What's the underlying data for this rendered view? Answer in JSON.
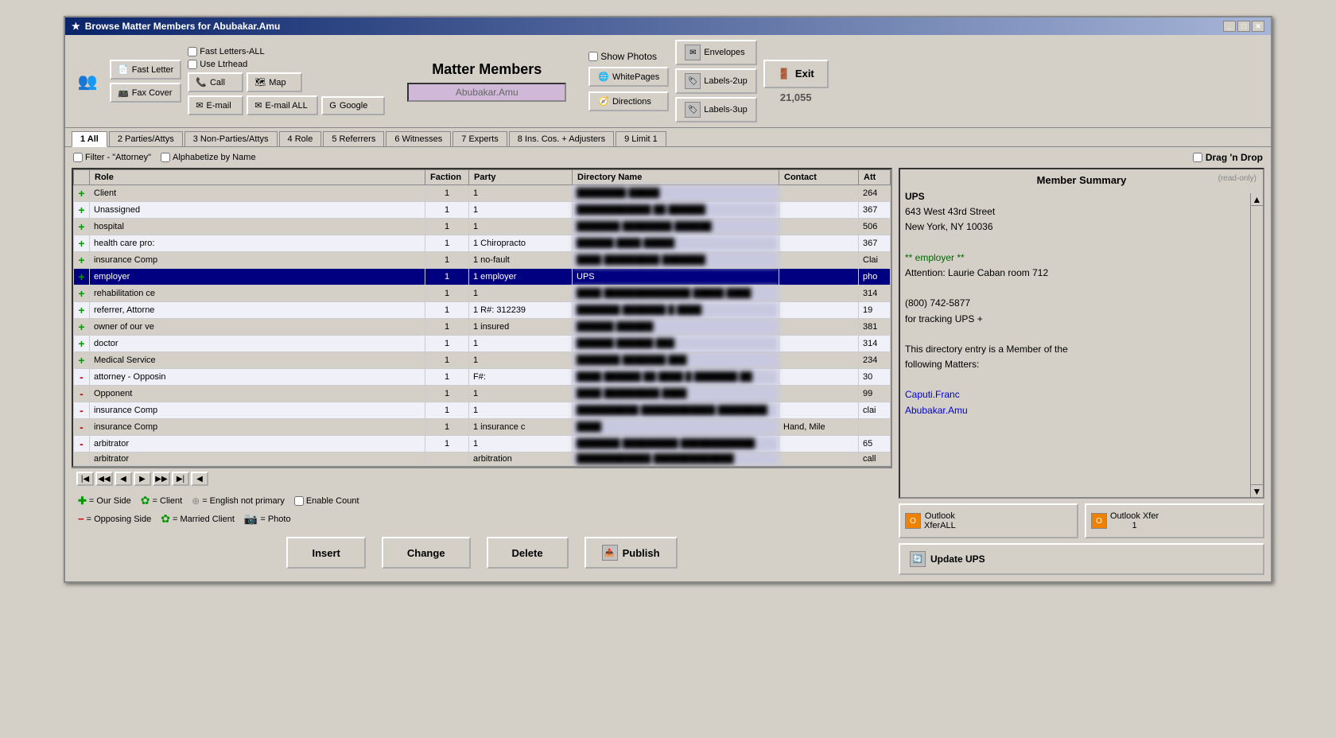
{
  "window": {
    "title": "Browse Matter Members for Abubakar.Amu",
    "title_icon": "★"
  },
  "toolbar": {
    "fast_letter_label": "Fast Letter",
    "fax_cover_label": "Fax Cover",
    "fast_letters_all": "Fast Letters-ALL",
    "use_ltrhead": "Use Ltrhead",
    "call_label": "Call",
    "map_label": "Map",
    "email_label": "E-mail",
    "email_all_label": "E-mail ALL",
    "google_label": "Google",
    "show_photos_label": "Show Photos",
    "whitepages_label": "WhitePages",
    "directions_label": "Directions",
    "envelopes_label": "Envelopes",
    "labels_2up_label": "Labels-2up",
    "labels_3up_label": "Labels-3up",
    "exit_label": "Exit",
    "matter_title": "Matter Members",
    "matter_name": "Abubakar.Amu",
    "count": "21,055"
  },
  "tabs": [
    {
      "id": "1",
      "label": "1 All",
      "active": true
    },
    {
      "id": "2",
      "label": "2 Parties/Attys"
    },
    {
      "id": "3",
      "label": "3 Non-Parties/Attys"
    },
    {
      "id": "4",
      "label": "4 Role"
    },
    {
      "id": "5",
      "label": "5 Referrers"
    },
    {
      "id": "6",
      "label": "6 Witnesses"
    },
    {
      "id": "7",
      "label": "7 Experts"
    },
    {
      "id": "8",
      "label": "8 Ins. Cos. + Adjusters"
    },
    {
      "id": "9",
      "label": "9 Limit 1"
    }
  ],
  "filter": {
    "filter_attorney": "Filter - \"Attorney\"",
    "alphabetize_label": "Alphabetize by Name",
    "drag_drop_label": "Drag 'n Drop"
  },
  "table": {
    "headers": [
      "Role",
      "Faction",
      "Party",
      "Directory Name",
      "Contact",
      "Att"
    ],
    "rows": [
      {
        "icon": "+",
        "role": "Client",
        "faction": "1",
        "party": "1",
        "dir_name": "████████ █████",
        "contact": "",
        "att": "264"
      },
      {
        "icon": "+",
        "role": "Unassigned",
        "faction": "1",
        "party": "1",
        "dir_name": "████████████ ██ ██████",
        "contact": "",
        "att": "367"
      },
      {
        "icon": "+",
        "role": "hospital",
        "faction": "1",
        "party": "1",
        "dir_name": "███████ ████████ ██████",
        "contact": "",
        "att": "506"
      },
      {
        "icon": "+",
        "role": "health care pro:",
        "faction": "1",
        "party": "1 Chiropracto",
        "dir_name": "██████ ████ █████",
        "contact": "",
        "att": "367"
      },
      {
        "icon": "+",
        "role": "insurance Comp",
        "faction": "1",
        "party": "1 no-fault",
        "dir_name": "████ █████████ ███████",
        "contact": "",
        "att": "Clai"
      },
      {
        "icon": "+",
        "role": "employer",
        "faction": "1",
        "party": "1 employer",
        "dir_name": "UPS",
        "contact": "",
        "att": "pho",
        "selected": true
      },
      {
        "icon": "+",
        "role": "rehabilitation ce",
        "faction": "1",
        "party": "1",
        "dir_name": "████ ██████████████ █████ ████",
        "contact": "",
        "att": "314"
      },
      {
        "icon": "+",
        "role": "referrer, Attorne",
        "faction": "1",
        "party": "1 R#: 312239",
        "dir_name": "███████ ███████ █ ████",
        "contact": "",
        "att": "19"
      },
      {
        "icon": "+",
        "role": "owner of our ve",
        "faction": "1",
        "party": "1 insured",
        "dir_name": "██████ ██████",
        "contact": "",
        "att": "381"
      },
      {
        "icon": "+",
        "role": "doctor",
        "faction": "1",
        "party": "1",
        "dir_name": "██████ ██████ ███",
        "contact": "",
        "att": "314"
      },
      {
        "icon": "+",
        "role": "Medical Service",
        "faction": "1",
        "party": "1",
        "dir_name": "███████ ███████ ███",
        "contact": "",
        "att": "234"
      },
      {
        "icon": "-",
        "role": "attorney - Opposin",
        "faction": "1",
        "party": "F#:",
        "dir_name": "████ ██████ ██ ████ █ ███████ ██",
        "contact": "",
        "att": "30"
      },
      {
        "icon": "-",
        "role": "Opponent",
        "faction": "1",
        "party": "1",
        "dir_name": "████ █████████ ████",
        "contact": "",
        "att": "99"
      },
      {
        "icon": "-",
        "role": "insurance Comp",
        "faction": "1",
        "party": "1",
        "dir_name": "██████████ ████████████ ████████",
        "contact": "",
        "att": "clai"
      },
      {
        "icon": "-",
        "role": "insurance Comp",
        "faction": "1",
        "party": "1 insurance c",
        "dir_name": "████",
        "contact": "Hand, Mile",
        "att": ""
      },
      {
        "icon": "-",
        "role": "arbitrator",
        "faction": "1",
        "party": "1",
        "dir_name": "███████ █████████ ████████████",
        "contact": "",
        "att": "65"
      },
      {
        "icon": "",
        "role": "arbitrator",
        "faction": "",
        "party": "arbitration",
        "dir_name": "████████████ █████████████",
        "contact": "",
        "att": "call"
      }
    ]
  },
  "legend": {
    "plus_desc": "= Our Side",
    "minus_desc": "= Opposing Side",
    "client_desc": "= Client",
    "english_desc": "= English not primary",
    "married_desc": "= Married Client",
    "photo_desc": "= Photo",
    "enable_count": "Enable Count"
  },
  "buttons": {
    "insert": "Insert",
    "change": "Change",
    "delete": "Delete",
    "publish": "Publish"
  },
  "member_summary": {
    "title": "Member Summary",
    "read_only": "(read-only)",
    "content_line1": "UPS",
    "content_line2": "643 West 43rd Street",
    "content_line3": "New York, NY  10036",
    "content_line4": "",
    "content_line5": "** employer **",
    "content_line6": "Attention: Laurie Caban room 712",
    "content_line7": "",
    "content_line8": "(800) 742-5877",
    "content_line9": "for tracking UPS +",
    "content_line10": "",
    "content_line11": "This directory entry is a Member of the",
    "content_line12": "following Matters:",
    "content_line13": "",
    "content_line14": "Caputi.Franc",
    "content_line15": "Abubakar.Amu"
  },
  "outlook": {
    "xfer_all_label": "Outlook\nXferALL",
    "xfer_label": "Outlook Xfer",
    "xfer_count": "1",
    "update_label": "Update UPS"
  }
}
